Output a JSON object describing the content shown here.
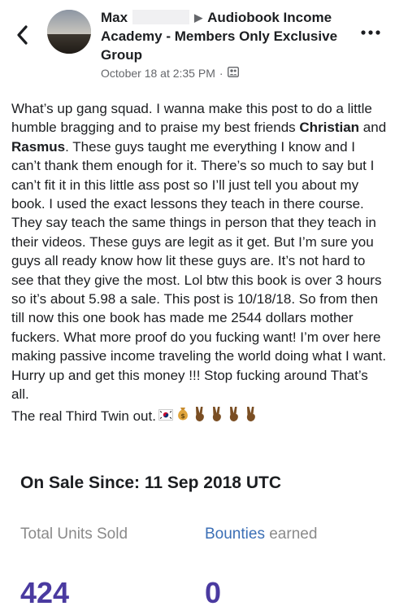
{
  "post": {
    "author_first": "Max",
    "group_name": "Audiobook Income Academy - Members Only Exclusive Group",
    "timestamp": "October 18 at 2:35 PM",
    "separator": "·",
    "body_1": "What’s up gang squad. I wanna make this post to do a little humble bragging and to praise my best friends ",
    "friend_1": "Christian",
    "and_word": " and ",
    "friend_2": "Rasmus",
    "body_2": ". These guys taught me everything I know and I can’t thank them enough for it. There’s so much to say but I can’t fit it in this little ass post so I’ll just tell you about my book. I used the exact lessons they teach in there course. They say teach the same things in person that they teach in their videos. These guys are legit as it get. But I’m sure you guys all ready know how lit these guys are. It’s not hard to see that they give the most.   Lol btw this book is over 3 hours so it’s about 5.98 a sale. This post is 10/18/18. So from then till now this one book has made me 2544 dollars mother fuckers. What more proof do you fucking want! I’m over here making passive income traveling the world doing what I want. Hurry up and get this money !!! Stop fucking around That’s all.",
    "sign_off": "The real Third Twin out."
  },
  "stats": {
    "on_sale_heading": "On Sale Since: 11 Sep 2018 UTC",
    "units_label": "Total Units Sold",
    "bounties_link": "Bounties",
    "bounties_rest": " earned",
    "units_value": "424",
    "bounties_value": "0"
  },
  "icons": {
    "back": "chevron-left-icon",
    "more": "ellipsis-icon",
    "group": "group-privacy-icon",
    "emojis": [
      "korea-flag",
      "money-bag",
      "victory-hand",
      "victory-hand",
      "victory-hand",
      "victory-hand"
    ]
  },
  "colors": {
    "value_purple": "#4a3aa0",
    "link_blue": "#3b6fb6",
    "muted": "#65676b"
  }
}
